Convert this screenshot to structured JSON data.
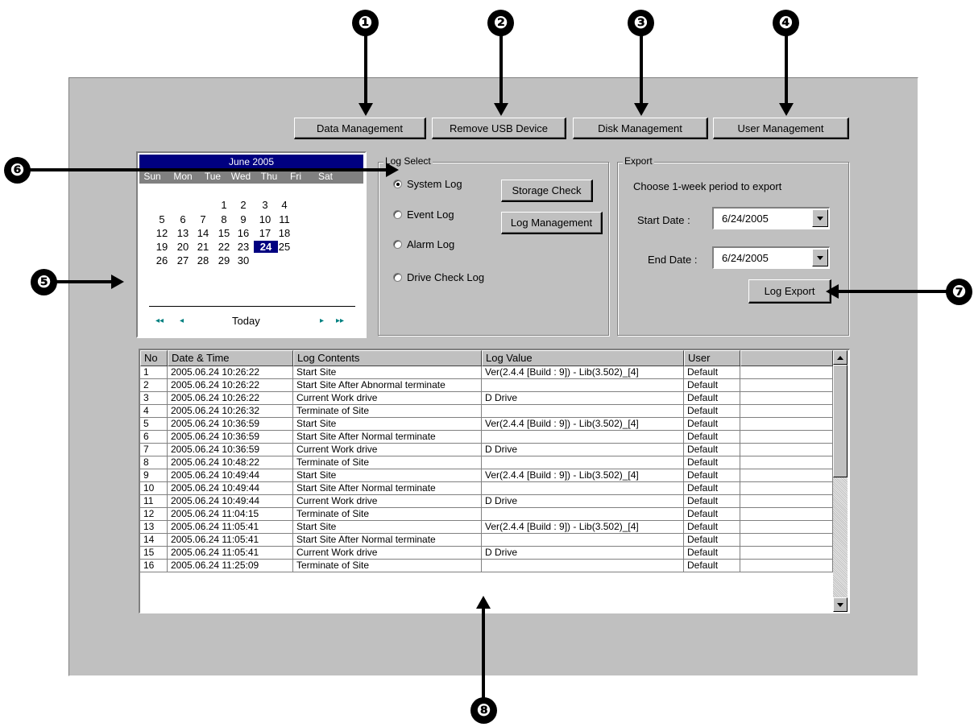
{
  "toolbar": {
    "data_management": "Data Management",
    "remove_usb": "Remove USB Device",
    "disk_management": "Disk Management",
    "user_management": "User Management"
  },
  "calendar": {
    "month_title": "June 2005",
    "weekdays": [
      "Sun",
      "Mon",
      "Tue",
      "Wed",
      "Thu",
      "Fri",
      "Sat"
    ],
    "days": [
      "1",
      "2",
      "3",
      "4",
      "5",
      "6",
      "7",
      "8",
      "9",
      "10",
      "11",
      "12",
      "13",
      "14",
      "15",
      "16",
      "17",
      "18",
      "19",
      "20",
      "21",
      "22",
      "23",
      "24",
      "25",
      "26",
      "27",
      "28",
      "29",
      "30"
    ],
    "selected_day": "24",
    "today_label": "Today",
    "nav_prev_year": "◂◂",
    "nav_prev_month": "◂",
    "nav_next_month": "▸",
    "nav_next_year": "▸▸"
  },
  "log_select": {
    "legend": "Log Select",
    "options": [
      "System Log",
      "Event Log",
      "Alarm Log",
      "Drive Check Log"
    ],
    "selected": "System Log",
    "storage_check": "Storage Check",
    "log_management": "Log Management"
  },
  "export": {
    "legend": "Export",
    "hint": "Choose 1-week period to export",
    "start_label": "Start Date :",
    "start_value": "6/24/2005",
    "end_label": "End Date :",
    "end_value": "6/24/2005",
    "button": "Log Export"
  },
  "table": {
    "columns": [
      "No",
      "Date & Time",
      "Log Contents",
      "Log Value",
      "User",
      ""
    ],
    "rows": [
      [
        "1",
        "2005.06.24 10:26:22",
        "Start Site",
        "Ver(2.4.4 [Build : 9]) - Lib(3.502)_[4]",
        "Default"
      ],
      [
        "2",
        "2005.06.24 10:26:22",
        "Start Site After Abnormal terminate",
        "",
        "Default"
      ],
      [
        "3",
        "2005.06.24 10:26:22",
        "Current Work drive",
        "D Drive",
        "Default"
      ],
      [
        "4",
        "2005.06.24 10:26:32",
        "Terminate of Site",
        "",
        "Default"
      ],
      [
        "5",
        "2005.06.24 10:36:59",
        "Start Site",
        "Ver(2.4.4 [Build : 9]) - Lib(3.502)_[4]",
        "Default"
      ],
      [
        "6",
        "2005.06.24 10:36:59",
        "Start Site After Normal terminate",
        "",
        "Default"
      ],
      [
        "7",
        "2005.06.24 10:36:59",
        "Current Work drive",
        "D Drive",
        "Default"
      ],
      [
        "8",
        "2005.06.24 10:48:22",
        "Terminate of Site",
        "",
        "Default"
      ],
      [
        "9",
        "2005.06.24 10:49:44",
        "Start Site",
        "Ver(2.4.4 [Build : 9]) - Lib(3.502)_[4]",
        "Default"
      ],
      [
        "10",
        "2005.06.24 10:49:44",
        "Start Site After Normal terminate",
        "",
        "Default"
      ],
      [
        "11",
        "2005.06.24 10:49:44",
        "Current Work drive",
        "D Drive",
        "Default"
      ],
      [
        "12",
        "2005.06.24 11:04:15",
        "Terminate of Site",
        "",
        "Default"
      ],
      [
        "13",
        "2005.06.24 11:05:41",
        "Start Site",
        "Ver(2.4.4 [Build : 9]) - Lib(3.502)_[4]",
        "Default"
      ],
      [
        "14",
        "2005.06.24 11:05:41",
        "Start Site After Normal terminate",
        "",
        "Default"
      ],
      [
        "15",
        "2005.06.24 11:05:41",
        "Current Work drive",
        "D Drive",
        "Default"
      ],
      [
        "16",
        "2005.06.24 11:25:09",
        "Terminate of Site",
        "",
        "Default"
      ]
    ]
  },
  "callouts": [
    "❶",
    "❷",
    "❸",
    "❹",
    "❺",
    "❻",
    "❼",
    "❽"
  ]
}
